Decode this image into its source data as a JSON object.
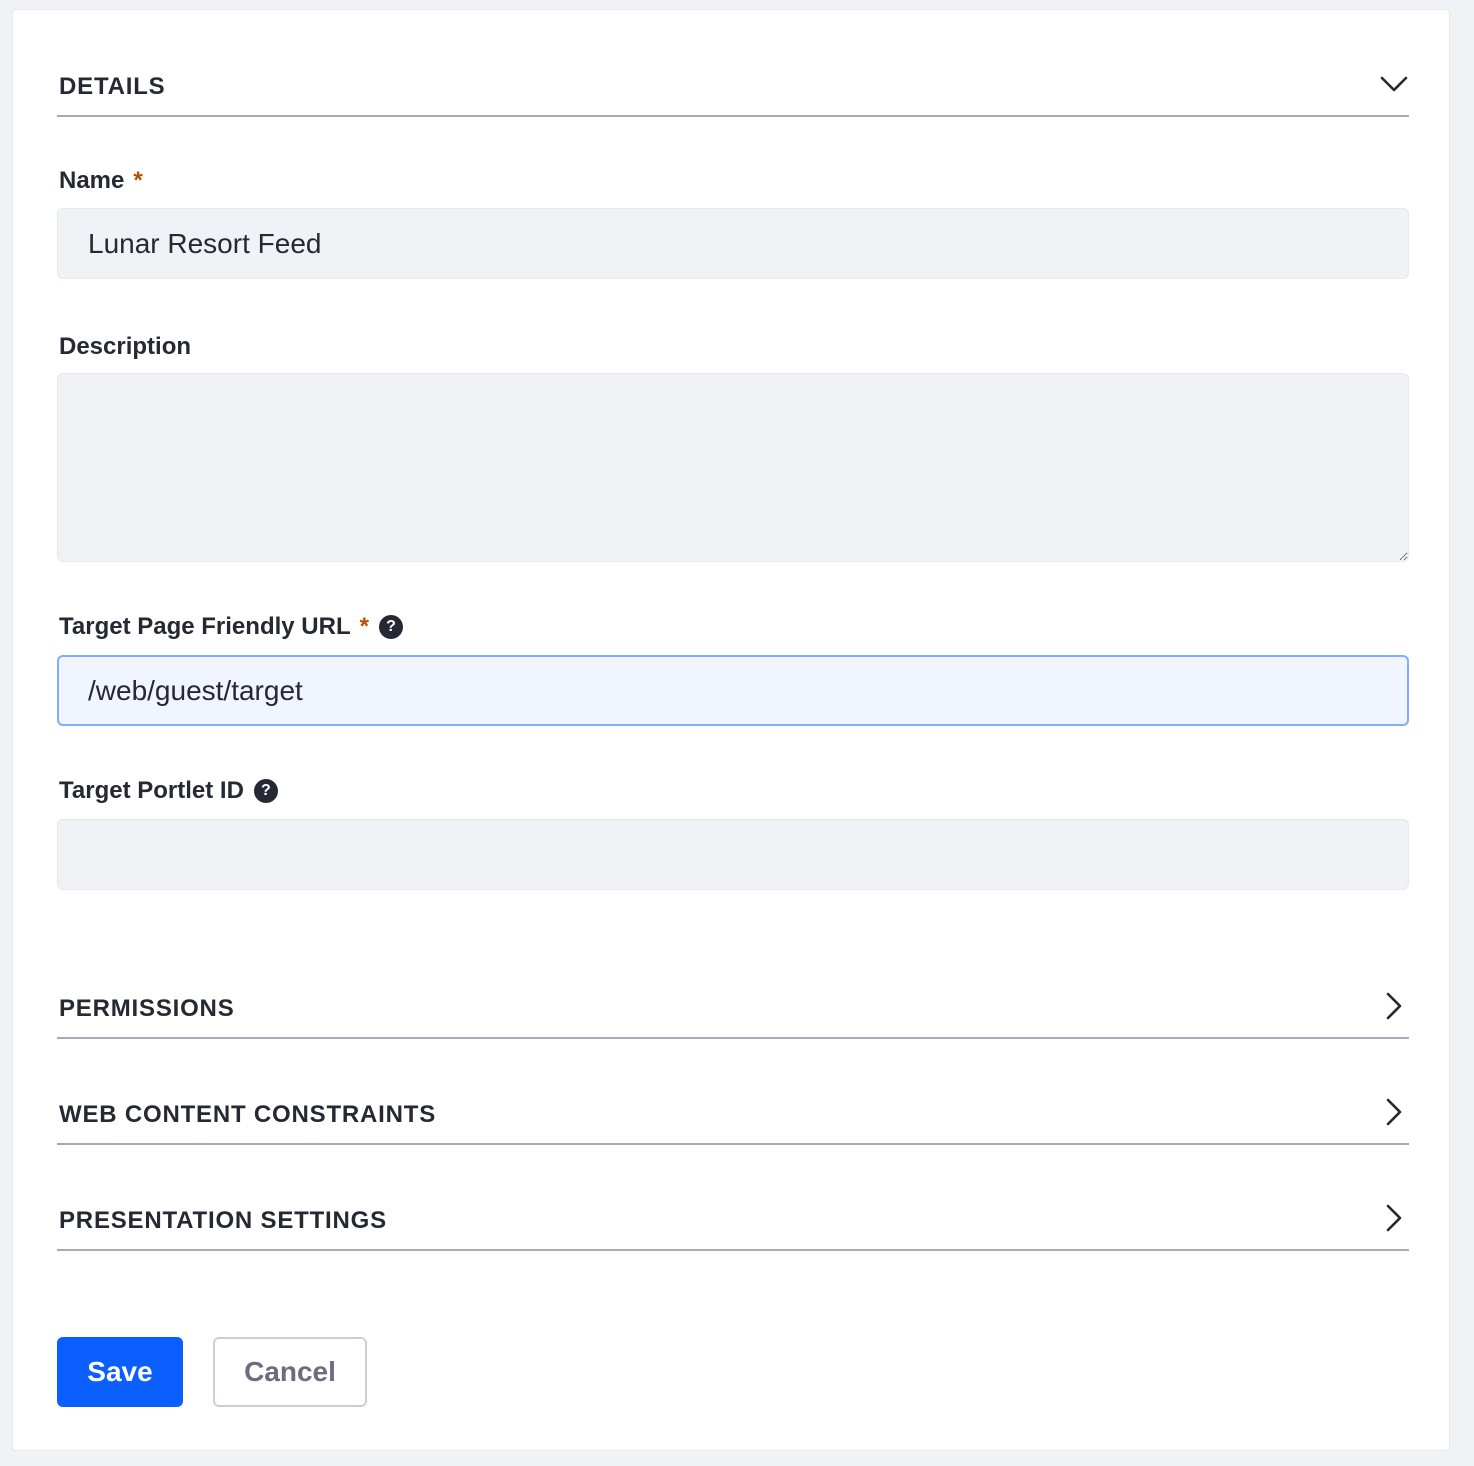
{
  "sections": {
    "details": {
      "title": "DETAILS",
      "icon": "chevron-down-icon",
      "expanded": true
    },
    "permissions": {
      "title": "PERMISSIONS",
      "icon": "chevron-right-icon",
      "expanded": false
    },
    "constraints": {
      "title": "WEB CONTENT CONSTRAINTS",
      "icon": "chevron-right-icon",
      "expanded": false
    },
    "presentation": {
      "title": "PRESENTATION SETTINGS",
      "icon": "chevron-right-icon",
      "expanded": false
    }
  },
  "form": {
    "name": {
      "label": "Name",
      "required_marker": "*",
      "value": "Lunar Resort Feed"
    },
    "description": {
      "label": "Description",
      "value": ""
    },
    "target_page_url": {
      "label": "Target Page Friendly URL",
      "required_marker": "*",
      "help_icon": "?",
      "value": "/web/guest/target"
    },
    "target_portlet_id": {
      "label": "Target Portlet ID",
      "help_icon": "?",
      "value": ""
    }
  },
  "buttons": {
    "save_label": "Save",
    "cancel_label": "Cancel"
  },
  "colors": {
    "primary": "#0b5fff",
    "required": "#b95000",
    "focus_border": "#80acff"
  }
}
